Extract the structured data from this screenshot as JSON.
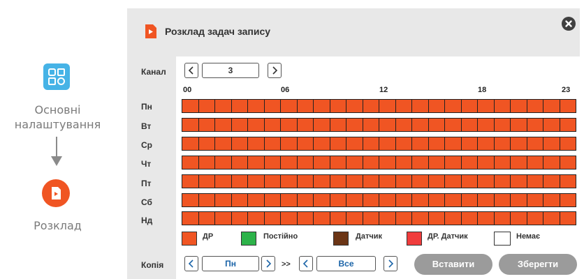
{
  "flow": {
    "step1_label_line1": "Основні",
    "step1_label_line2": "налаштування",
    "step2_label": "Розклад",
    "step1_icon": "settings-grid-icon",
    "step2_icon": "schedule-doc-icon"
  },
  "dialog": {
    "title": "Розклад задач запису",
    "close_icon": "close-icon"
  },
  "channel": {
    "label": "Канал",
    "value": "3",
    "prev": "<",
    "next": ">"
  },
  "hours": [
    "00",
    "06",
    "12",
    "18",
    "23"
  ],
  "days": [
    "Пн",
    "Вт",
    "Ср",
    "Чт",
    "Пт",
    "Сб",
    "Нд"
  ],
  "legend": [
    {
      "label": "ДР",
      "color": "#f05523"
    },
    {
      "label": "Постійно",
      "color": "#2db34a"
    },
    {
      "label": "Датчик",
      "color": "#6b3515"
    },
    {
      "label": "ДР. Датчик",
      "color": "#f03c3c"
    },
    {
      "label": "Немає",
      "color": "#ffffff"
    }
  ],
  "copy": {
    "label": "Копія",
    "from_value": "Пн",
    "arrow": ">>",
    "to_value": "Все",
    "prev": "<",
    "next": ">"
  },
  "buttons": {
    "paste": "Вставити",
    "save": "Зберегти"
  },
  "colors": {
    "schedule_fill": "#f05523",
    "accent_blue": "#46b3e6",
    "accent_orange": "#f05523"
  }
}
